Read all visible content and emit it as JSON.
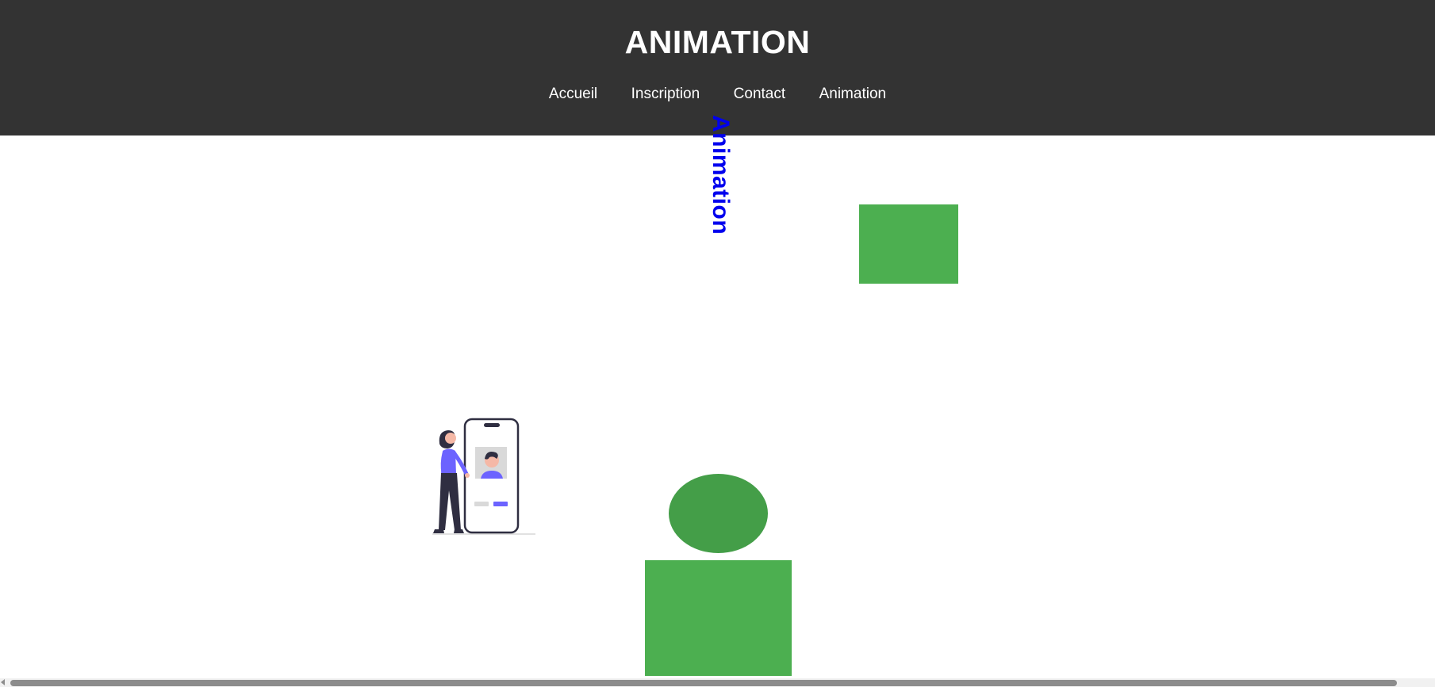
{
  "header": {
    "title": "ANIMATION",
    "nav": [
      {
        "label": "Accueil"
      },
      {
        "label": "Inscription"
      },
      {
        "label": "Contact"
      },
      {
        "label": "Animation"
      }
    ]
  },
  "main": {
    "rotated_label": "Animation",
    "illustration_icon": "woman-with-smartphone-profile-illustration",
    "shapes": [
      {
        "kind": "rectangle",
        "color": "#4caf50"
      },
      {
        "kind": "ellipse",
        "color": "#449e48"
      },
      {
        "kind": "rectangle",
        "color": "#4caf50"
      }
    ]
  },
  "colors": {
    "header_bg": "#333333",
    "nav_text": "#ffffff",
    "label_blue": "#0000ee",
    "accent_purple": "#6c63ff"
  }
}
